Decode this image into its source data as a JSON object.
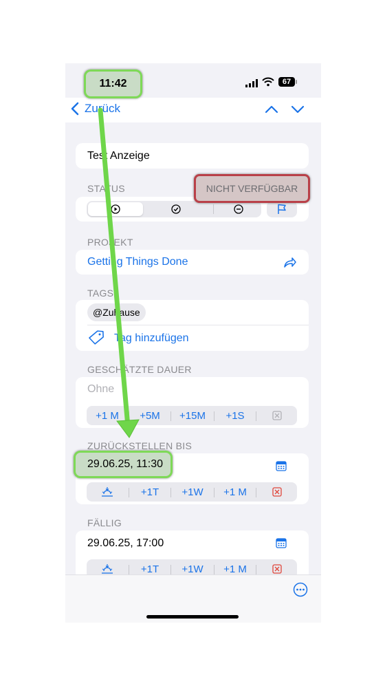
{
  "status_bar": {
    "time": "11:42",
    "battery": "67"
  },
  "nav": {
    "back_label": "Zurück"
  },
  "task": {
    "title": "Test Anzeige"
  },
  "status": {
    "label": "STATUS",
    "badge": "NICHT VERFÜGBAR"
  },
  "project": {
    "label": "PROJEKT",
    "name": "Getting Things Done"
  },
  "tags": {
    "label": "TAGS",
    "tag": "@Zuhause",
    "add_label": "Tag hinzufügen"
  },
  "duration": {
    "label": "GESCHÄTZTE DAUER",
    "placeholder": "Ohne",
    "options": [
      "+1 M",
      "+5M",
      "+15M",
      "+1S"
    ]
  },
  "defer": {
    "label": "ZURÜCKSTELLEN BIS",
    "value": "29.06.25, 11:30",
    "options": [
      "+1T",
      "+1W",
      "+1 M"
    ]
  },
  "due": {
    "label": "FÄLLIG",
    "value": "29.06.25, 17:00",
    "options": [
      "+1T",
      "+1W",
      "+1 M"
    ]
  },
  "colors": {
    "accent": "#1a73e8",
    "highlight_green": "#7ed957",
    "highlight_red": "#b94048",
    "arrow": "#6fd64a"
  }
}
